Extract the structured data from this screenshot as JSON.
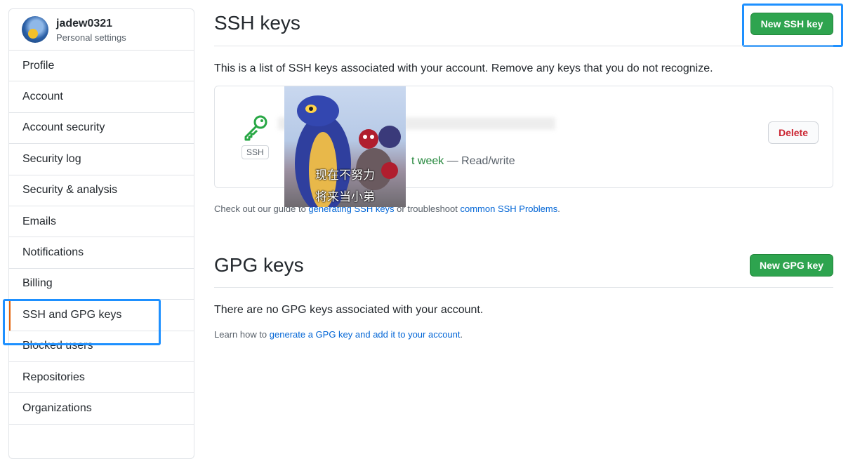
{
  "sidebar": {
    "username": "jadew0321",
    "subtitle": "Personal settings",
    "items": [
      {
        "label": "Profile"
      },
      {
        "label": "Account"
      },
      {
        "label": "Account security"
      },
      {
        "label": "Security log"
      },
      {
        "label": "Security & analysis"
      },
      {
        "label": "Emails"
      },
      {
        "label": "Notifications"
      },
      {
        "label": "Billing"
      },
      {
        "label": "SSH and GPG keys",
        "selected": true
      },
      {
        "label": "Blocked users"
      },
      {
        "label": "Repositories"
      },
      {
        "label": "Organizations"
      }
    ]
  },
  "ssh": {
    "title": "SSH keys",
    "new_button": "New SSH key",
    "description": "This is a list of SSH keys associated with your account. Remove any keys that you do not recognize.",
    "key": {
      "badge": "SSH",
      "last_used_fragment": "t week",
      "access": "— Read/write",
      "delete_label": "Delete"
    },
    "footer_prefix": "Check out our guide to ",
    "footer_link1": "generating SSH keys",
    "footer_mid": " or troubleshoot ",
    "footer_link2": "common SSH Problems",
    "footer_suffix": "."
  },
  "gpg": {
    "title": "GPG keys",
    "new_button": "New GPG key",
    "empty_message": "There are no GPG keys associated with your account.",
    "learn_prefix": "Learn how to ",
    "learn_link": "generate a GPG key and add it to your account",
    "learn_suffix": "."
  },
  "overlay": {
    "caption_line1": "现在不努力",
    "caption_line2": "将来当小弟"
  },
  "colors": {
    "accent_green": "#2ea44f",
    "link_blue": "#0366d6",
    "highlight_blue": "#1e90ff",
    "danger_red": "#cb2431",
    "selected_marker": "#e36209"
  }
}
